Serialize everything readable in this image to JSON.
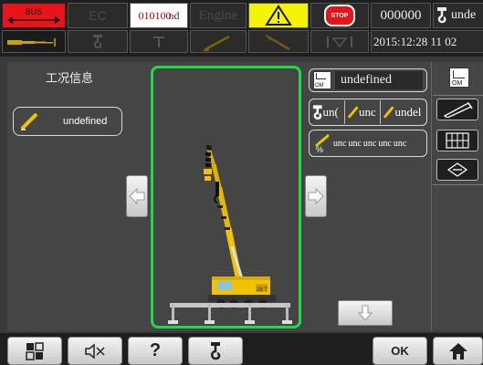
{
  "topbar": {
    "bus_label": "BUS",
    "ec_label": "EC",
    "code_value": "010100",
    "code_suffix": "nd",
    "engine_label": "Engine",
    "warning_icon": "warning-triangle-icon",
    "stop_label": "STOP",
    "counter_value": "000000",
    "hook_value": "unde",
    "datetime_value": "2015:12:28  11  02",
    "colors": {
      "bus_bg": "#e8141a",
      "warning_bg": "#f4f400",
      "stop_bg": "#e8141a",
      "code_text": "#d00000"
    }
  },
  "work_info": {
    "title": "工况信息",
    "boom_value": "undefined"
  },
  "camera": {
    "border_color": "#22d84a",
    "crane_plate": "28 T"
  },
  "right_info": {
    "om_label": "OM",
    "om_value": "undefined",
    "hook_value": "un(",
    "boom_value": "unc",
    "jib_value": "undel",
    "percent_values": [
      "unc",
      "unc",
      "unc",
      "unc",
      "unc"
    ]
  },
  "bottombar": {
    "ok_label": "OK",
    "help_label": "?"
  }
}
